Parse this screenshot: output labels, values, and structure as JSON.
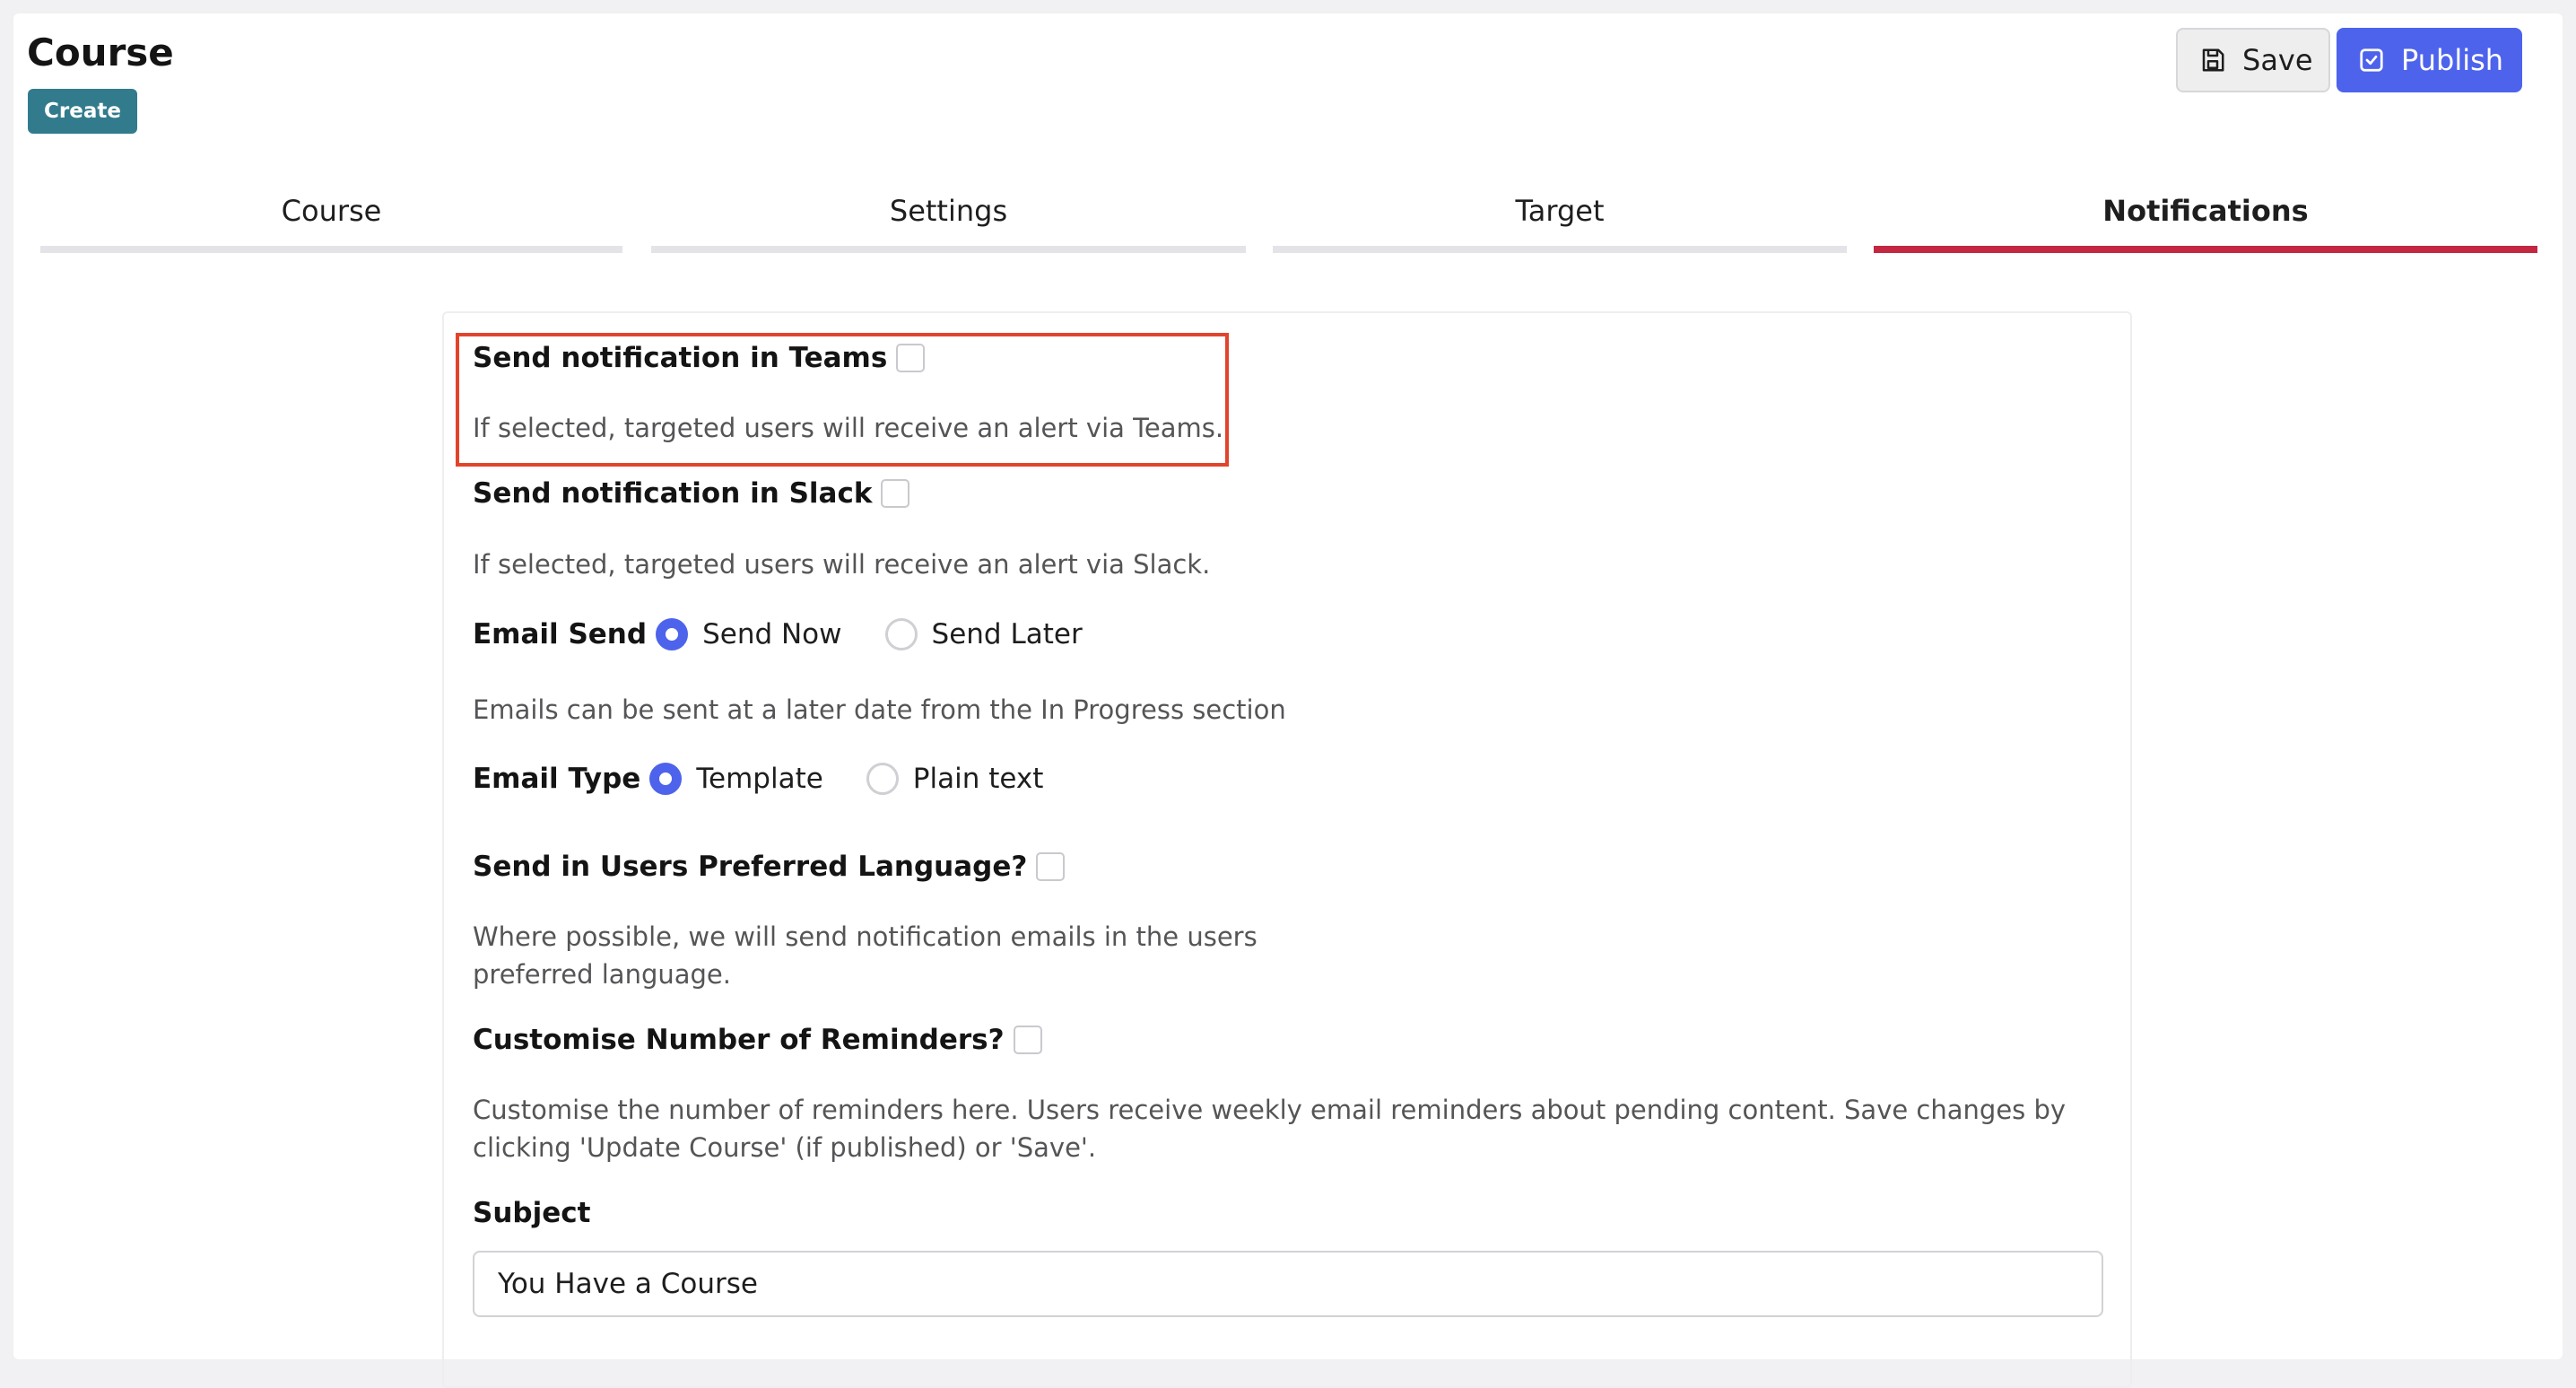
{
  "header": {
    "title": "Course",
    "badge": "Create",
    "save_label": "Save",
    "publish_label": "Publish"
  },
  "tabs": [
    {
      "label": "Course",
      "active": false
    },
    {
      "label": "Settings",
      "active": false
    },
    {
      "label": "Target",
      "active": false
    },
    {
      "label": "Notifications",
      "active": true
    }
  ],
  "form": {
    "teams": {
      "label": "Send notification in Teams",
      "checked": false,
      "help": "If selected, targeted users will receive an alert via Teams."
    },
    "slack": {
      "label": "Send notification in Slack",
      "checked": false,
      "help": "If selected, targeted users will receive an alert via Slack."
    },
    "email_send": {
      "label": "Email Send",
      "options": [
        "Send Now",
        "Send Later"
      ],
      "selected": "Send Now",
      "help": "Emails can be sent at a later date from the In Progress section"
    },
    "email_type": {
      "label": "Email Type",
      "options": [
        "Template",
        "Plain text"
      ],
      "selected": "Template"
    },
    "preferred_language": {
      "label": "Send in Users Preferred Language?",
      "checked": false,
      "help": "Where possible, we will send notification emails in the users preferred language."
    },
    "reminders": {
      "label": "Customise Number of Reminders?",
      "checked": false,
      "help": "Customise the number of reminders here. Users receive weekly email reminders about pending content. Save changes by clicking 'Update Course' (if published) or 'Save'."
    },
    "subject": {
      "label": "Subject",
      "value": "You Have a Course"
    }
  },
  "colors": {
    "accent": "#4d63ec",
    "active_tab": "#c32741",
    "badge": "#327b8c",
    "highlight": "#e2442b"
  }
}
